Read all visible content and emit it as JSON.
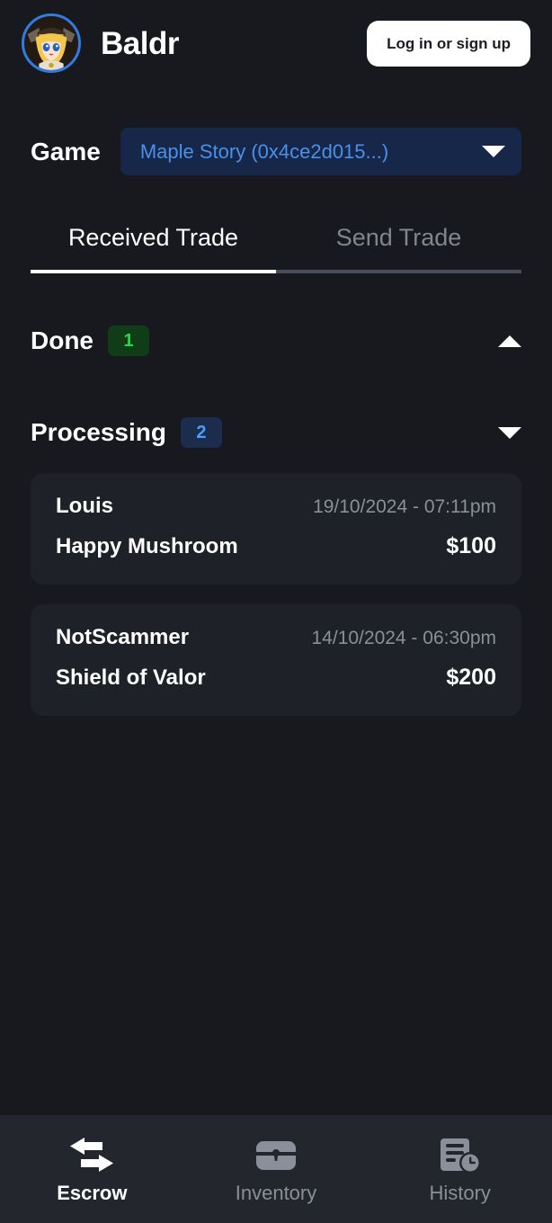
{
  "header": {
    "brand_title": "Baldr",
    "avatar_icon": "user-avatar-anime-character",
    "login_label": "Log in or sign up"
  },
  "game": {
    "label": "Game",
    "selected": "Maple Story (0x4ce2d015...)",
    "caret_icon": "chevron-down-icon"
  },
  "tabs": [
    {
      "label": "Received Trade",
      "active": true
    },
    {
      "label": "Send Trade",
      "active": false
    }
  ],
  "sections": [
    {
      "title": "Done",
      "count": "1",
      "badge_color": "#28d64a",
      "badge_bg": "#103d18",
      "toggle_icon": "chevron-up-icon",
      "expanded": false
    },
    {
      "title": "Processing",
      "count": "2",
      "badge_color": "#4a9eff",
      "badge_bg": "#1b2c4d",
      "toggle_icon": "chevron-down-icon",
      "expanded": true
    }
  ],
  "trades": [
    {
      "user": "Louis",
      "date": "19/10/2024 - 07:11pm",
      "item": "Happy Mushroom",
      "amount": "$100"
    },
    {
      "user": "NotScammer",
      "date": "14/10/2024 - 06:30pm",
      "item": "Shield of Valor",
      "amount": "$200"
    }
  ],
  "bottom_nav": [
    {
      "label": "Escrow",
      "icon": "exchange-arrows-icon",
      "active": true
    },
    {
      "label": "Inventory",
      "icon": "treasure-chest-icon",
      "active": false
    },
    {
      "label": "History",
      "icon": "document-clock-icon",
      "active": false
    }
  ],
  "colors": {
    "page_bg": "#17191e",
    "card_bg": "#1e2127",
    "nav_bg": "#23262c",
    "accent_blue": "#4a90e8",
    "select_bg": "#17274a",
    "muted_text": "#8a8f99"
  }
}
